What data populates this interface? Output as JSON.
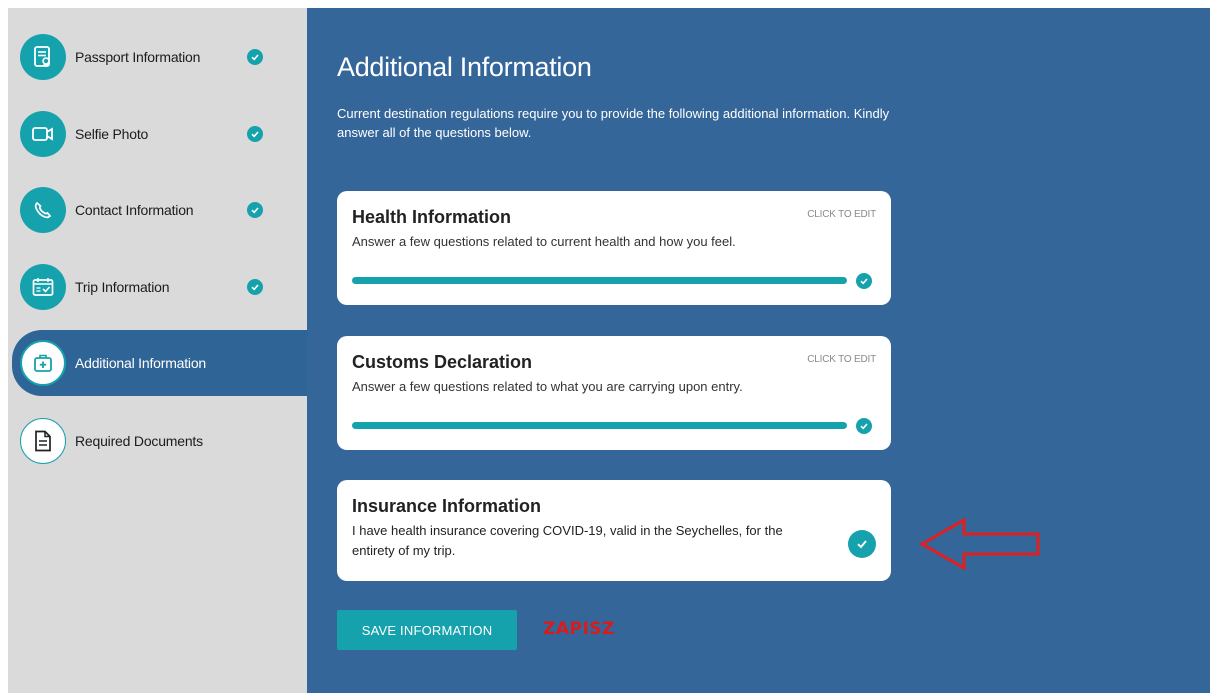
{
  "sidebar": {
    "items": [
      {
        "label": "Passport Information",
        "icon": "passport-icon",
        "completed": true
      },
      {
        "label": "Selfie Photo",
        "icon": "camera-icon",
        "completed": true
      },
      {
        "label": "Contact Information",
        "icon": "phone-icon",
        "completed": true
      },
      {
        "label": "Trip Information",
        "icon": "calendar-icon",
        "completed": true
      },
      {
        "label": "Additional Information",
        "icon": "medical-kit-icon",
        "active": true
      },
      {
        "label": "Required Documents",
        "icon": "document-icon",
        "completed": false
      }
    ]
  },
  "main": {
    "title": "Additional Information",
    "intro": "Current destination regulations require you to provide the following additional information. Kindly answer all of the questions below.",
    "cards": [
      {
        "title": "Health Information",
        "edit_label": "CLICK TO EDIT",
        "description": "Answer a few questions related to current health and how you feel.",
        "progress": 1.0
      },
      {
        "title": "Customs Declaration",
        "edit_label": "CLICK TO EDIT",
        "description": "Answer a few questions related to what you are carrying upon entry.",
        "progress": 1.0
      },
      {
        "title": "Insurance Information",
        "description": "I have health insurance covering COVID-19, valid in the Seychelles, for the entirety of my trip.",
        "checked": true
      }
    ],
    "save_label": "SAVE INFORMATION"
  },
  "annotation": {
    "text": "ZAPISZ",
    "arrow": "left-arrow-icon"
  },
  "colors": {
    "teal": "#16a2ac",
    "panel_blue": "#356699",
    "sidebar_gray": "#dadada",
    "annotation_red": "#d81c1c"
  }
}
